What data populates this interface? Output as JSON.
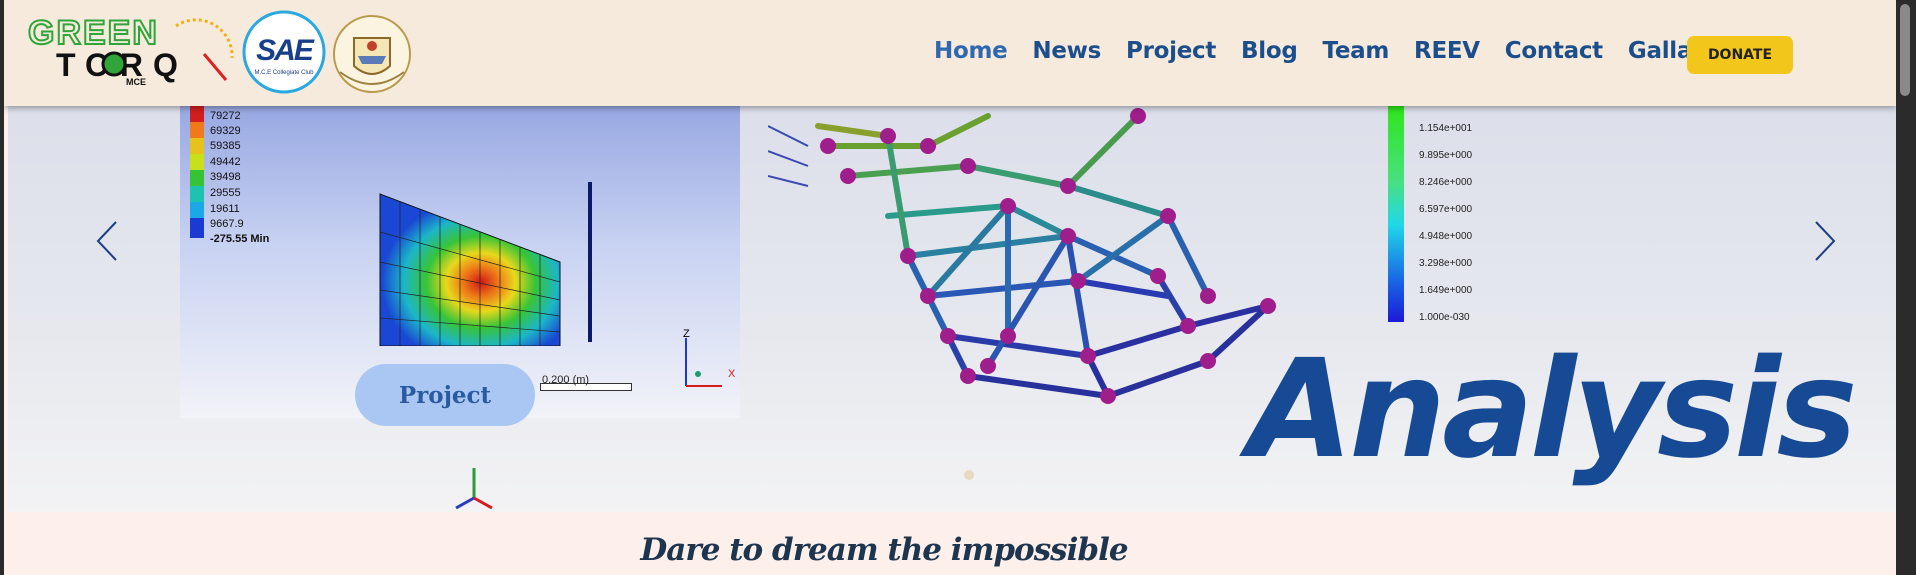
{
  "header": {
    "logo_greentorq": {
      "line1": "GREEN",
      "line2": "TORQ",
      "sub": "MCE"
    },
    "logo_sae": {
      "main": "SAE",
      "sub": "M.C.E Collegiate Club"
    },
    "nav": [
      "Home",
      "News",
      "Project",
      "Blog",
      "Team",
      "REEV",
      "Contact",
      "Gallary"
    ],
    "active_nav": "Home",
    "donate_label": "DONATE"
  },
  "hero": {
    "fea_legend": [
      "79272",
      "69329",
      "59385",
      "49442",
      "39498",
      "29555",
      "19611",
      "9667.9",
      "-275.55 Min"
    ],
    "scale_label": "0.200 (m)",
    "axis_z": "Z",
    "axis_x": "X",
    "color_scale": [
      "1.154e+001",
      "9.895e+000",
      "8.246e+000",
      "6.597e+000",
      "4.948e+000",
      "3.298e+000",
      "1.649e+000",
      "1.000e-030"
    ],
    "project_button": "Project",
    "headline": "Analysis"
  },
  "tagline": "Dare to dream the impossible",
  "colors": {
    "header_bg": "#f6eadc",
    "nav_text": "#1c4e8c",
    "donate_bg": "#f3c61c",
    "headline": "#174a94",
    "pill_bg": "#a9c7f2"
  }
}
